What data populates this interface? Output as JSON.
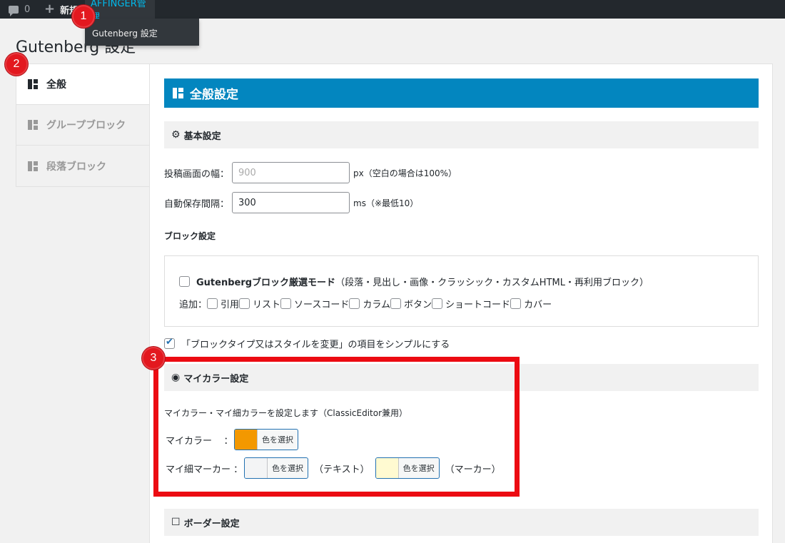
{
  "adminbar": {
    "comments_count": "0",
    "new_label": "新規",
    "affinger_label": "AFFINGER管理",
    "dropdown_item": "Gutenberg 設定"
  },
  "badges": [
    "1",
    "2",
    "3"
  ],
  "page_title": "Gutenberg 設定",
  "tabs": [
    {
      "label": "全般",
      "active": true
    },
    {
      "label": "グループブロック",
      "active": false
    },
    {
      "label": "段落ブロック",
      "active": false
    }
  ],
  "main": {
    "section_title": "全般設定",
    "basic": {
      "title": "基本設定",
      "width_label": "投稿画面の幅：",
      "width_placeholder": "900",
      "width_suffix": "px（空白の場合は100%）",
      "autosave_label": "自動保存間隔：",
      "autosave_value": "300",
      "autosave_suffix": "ms（※最低10）"
    },
    "block": {
      "title": "ブロック設定",
      "strict_mode_bold": "Gutenbergブロック厳選モード",
      "strict_mode_rest": "（段落・見出し・画像・クラッシック・カスタムHTML・再利用ブロック）",
      "add_label": "追加：",
      "options": [
        "引用",
        "リスト",
        "ソースコード",
        "カラム",
        "ボタン",
        "ショートコード",
        "カバー"
      ],
      "simple_label": "「ブロックタイプ又はスタイルを変更」の項目をシンプルにする",
      "simple_checked": true
    },
    "mycolor": {
      "title": "マイカラー設定",
      "description": "マイカラー・マイ細カラーを設定します（ClassicEditor兼用）",
      "mycolor_label": "マイカラー",
      "colon": "：",
      "marker_label": "マイ細マーカー",
      "select_label": "色を選択",
      "text_paren": "（テキスト）",
      "marker_paren": "（マーカー）",
      "colors": {
        "mycolor": "#f39800",
        "marker_text": "#f3f4f5",
        "marker_marker": "#fffad1"
      }
    },
    "border": {
      "title": "ボーダー設定"
    }
  },
  "colors": {
    "accent_blue": "#0386bf",
    "highlight_red": "#ec0b12",
    "adminbar": "#23282d"
  }
}
